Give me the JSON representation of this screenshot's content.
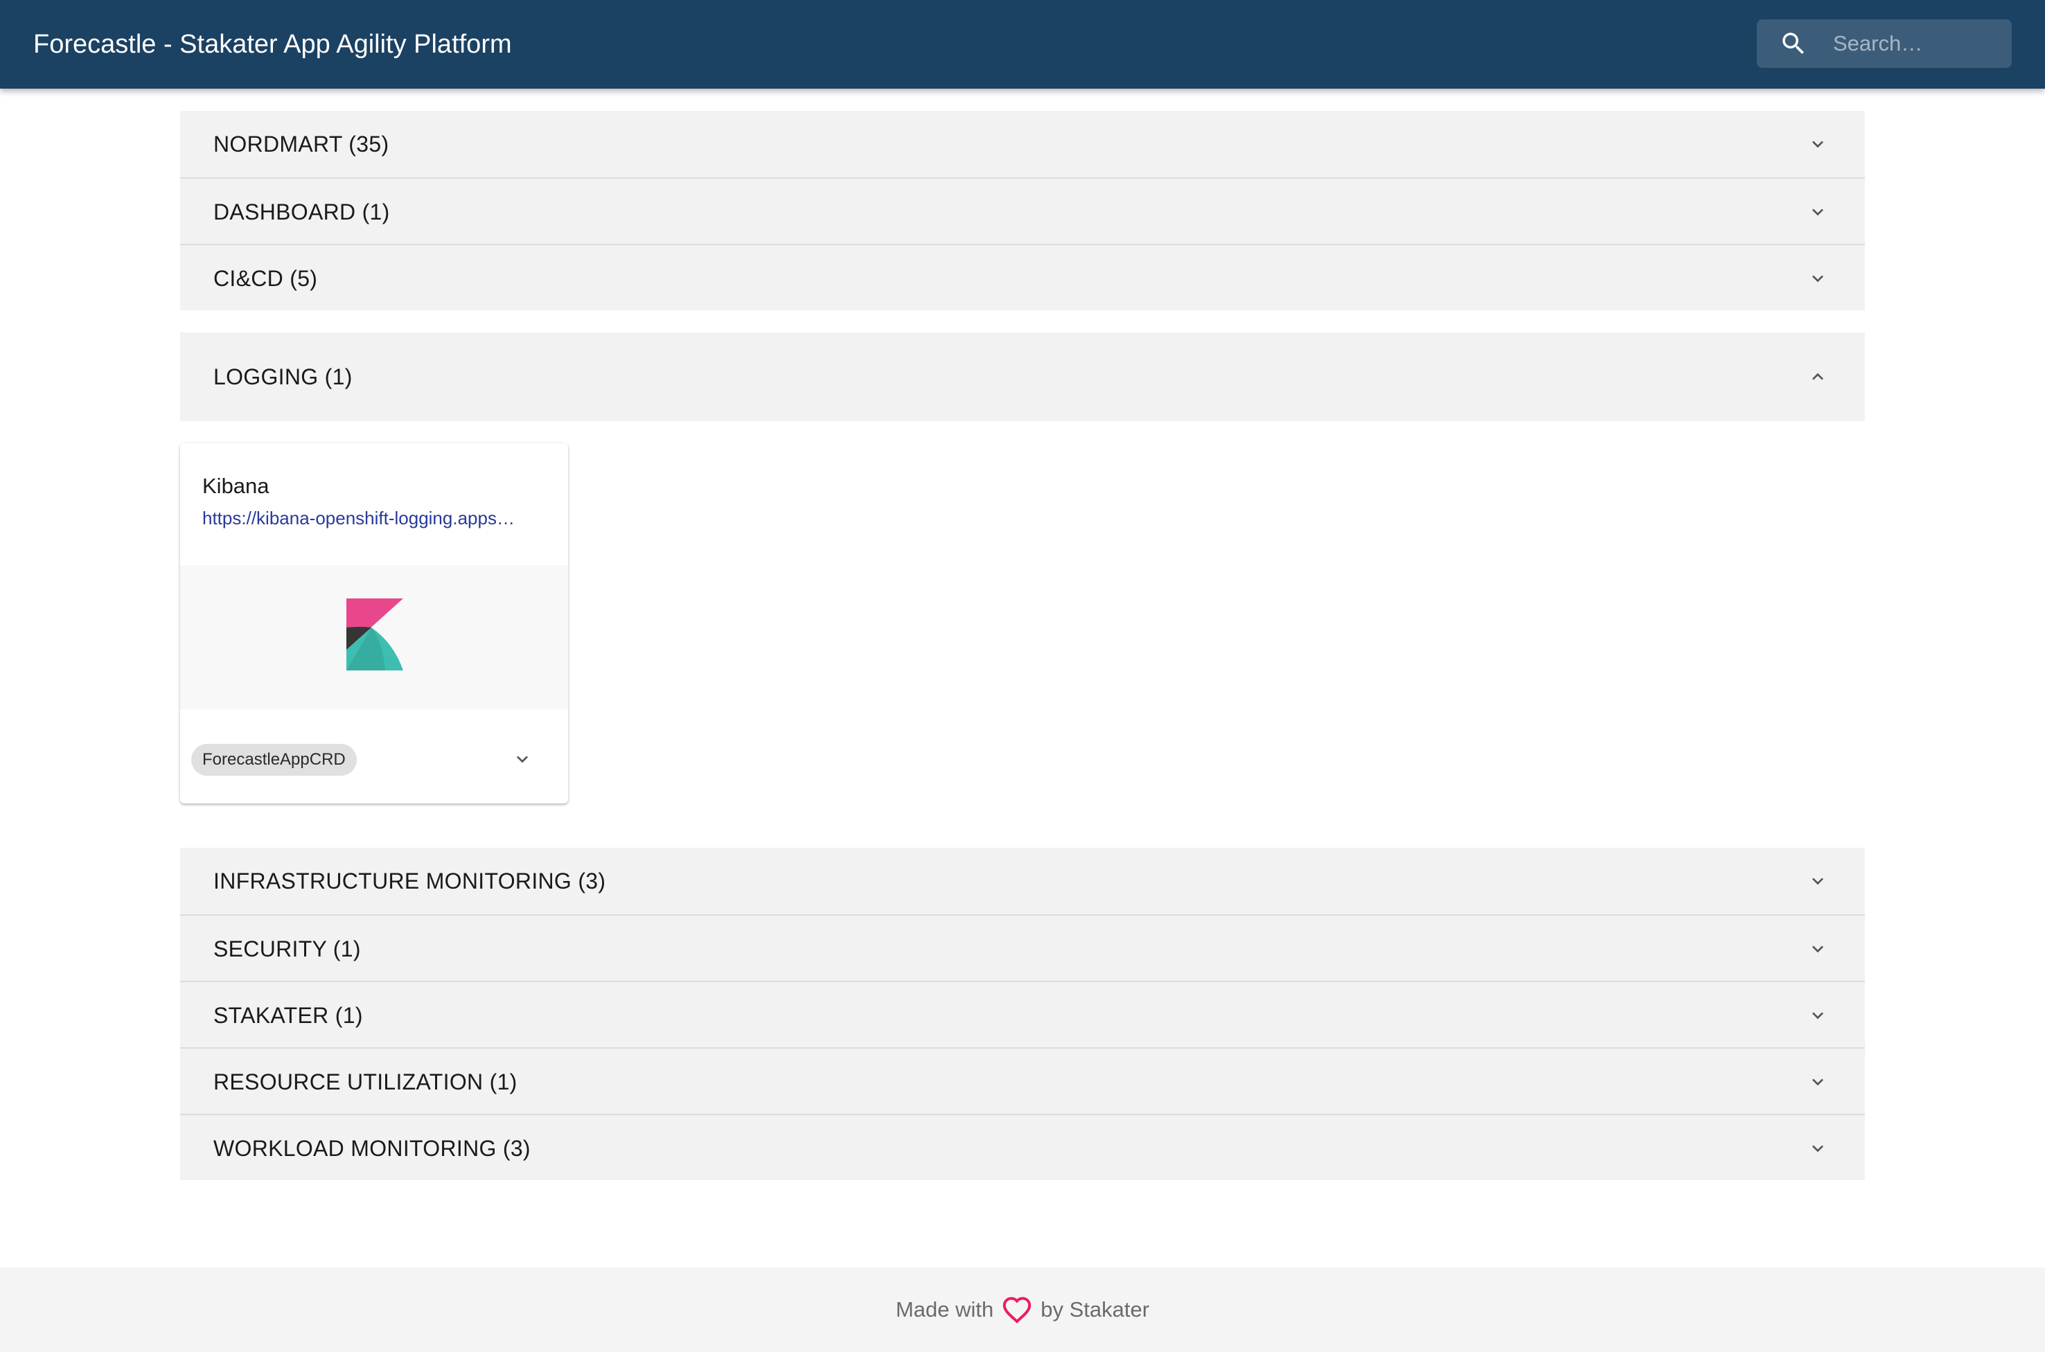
{
  "appbar": {
    "title": "Forecastle - Stakater App Agility Platform",
    "search_placeholder": "Search…"
  },
  "groups_top": [
    {
      "label": "NORDMART (35)"
    },
    {
      "label": "DASHBOARD (1)"
    },
    {
      "label": "CI&CD (5)"
    }
  ],
  "expanded_group": {
    "label": "LOGGING (1)",
    "apps": [
      {
        "title": "Kibana",
        "url": "https://kibana-openshift-logging.apps…",
        "chip": "ForecastleAppCRD",
        "icon": "kibana-logo"
      }
    ]
  },
  "groups_bottom": [
    {
      "label": "INFRASTRUCTURE MONITORING (3)"
    },
    {
      "label": "SECURITY (1)"
    },
    {
      "label": "STAKATER (1)"
    },
    {
      "label": "RESOURCE UTILIZATION (1)"
    },
    {
      "label": "WORKLOAD MONITORING (3)"
    }
  ],
  "footer": {
    "made_with": "Made with",
    "by": "by Stakater",
    "heart_color": "#e91e63"
  },
  "colors": {
    "appbar": "#1b4163",
    "panel": "#f2f2f2",
    "link": "#283a9a",
    "kibana_pink": "#e8488b",
    "kibana_teal": "#3ebeb0",
    "kibana_dark": "#353535"
  }
}
